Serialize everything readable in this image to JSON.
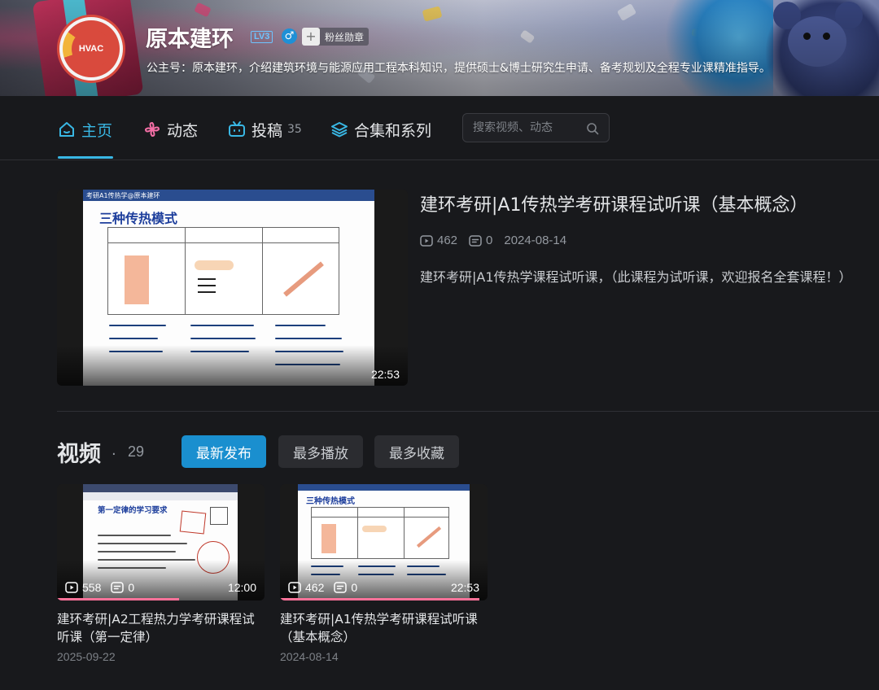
{
  "profile": {
    "name": "原本建环",
    "level": "LV3",
    "gender": "♂",
    "fan_badge": "粉丝勋章",
    "bio": "公主号：原本建环，介绍建筑环境与能源应用工程本科知识，提供硕士&博士研究生申请、备考规划及全程专业课精准指导。",
    "avatar_text": "HVAC"
  },
  "nav": {
    "home": "主页",
    "dynamic": "动态",
    "uploads": "投稿",
    "uploads_count": "35",
    "collections": "合集和系列",
    "search_placeholder": "搜索视频、动态"
  },
  "featured": {
    "title": "建环考研|A1传热学考研课程试听课（基本概念）",
    "views": "462",
    "comments": "0",
    "date": "2024-08-14",
    "description": "建环考研|A1传热学课程试听课，（此课程为试听课，欢迎报名全套课程！）",
    "duration": "22:53",
    "slide_header": "考研A1传热学@原本建环",
    "slide_title": "三种传热模式"
  },
  "videos": {
    "title": "视频",
    "dot": "·",
    "count": "29",
    "sort_options": [
      "最新发布",
      "最多播放",
      "最多收藏"
    ],
    "items": [
      {
        "views": "558",
        "comments": "0",
        "duration": "12:00",
        "title": "建环考研|A2工程热力学考研课程试听课（第一定律）",
        "date": "2025-09-22",
        "slide_title": "第一定律的学习要求"
      },
      {
        "views": "462",
        "comments": "0",
        "duration": "22:53",
        "title": "建环考研|A1传热学考研课程试听课（基本概念）",
        "date": "2024-08-14",
        "slide_title": "三种传热模式"
      }
    ]
  },
  "colors": {
    "accent": "#39b7e4",
    "active_button": "#1a8fcf",
    "background": "#18191c",
    "progress": "#fb7299"
  }
}
